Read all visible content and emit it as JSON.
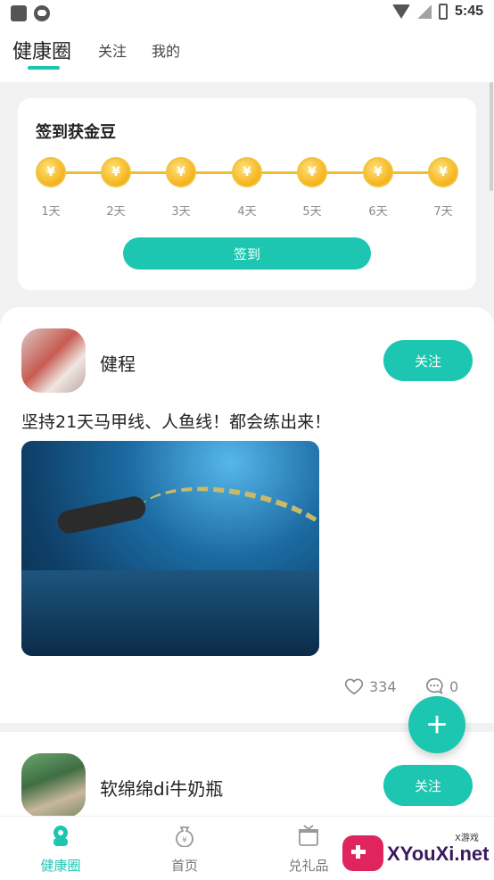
{
  "status_bar": {
    "time": "5:45"
  },
  "top_tabs": {
    "active": "健康圈",
    "follow": "关注",
    "mine": "我的"
  },
  "checkin": {
    "title": "签到获金豆",
    "coin_symbol": "¥",
    "days": [
      "1天",
      "2天",
      "3天",
      "4天",
      "5天",
      "6天",
      "7天"
    ],
    "button": "签到"
  },
  "posts": [
    {
      "username": "健程",
      "follow_label": "关注",
      "text": "坚持21天马甲线、人鱼线！都会练出来！",
      "likes": "334",
      "comments": "0"
    },
    {
      "username": "软绵绵di牛奶瓶",
      "follow_label": "关注"
    }
  ],
  "fab": {
    "symbol": "+"
  },
  "bottom_nav": [
    {
      "label": "健康圈",
      "active": true
    },
    {
      "label": "首页",
      "active": false
    },
    {
      "label": "兑礼品",
      "active": false
    }
  ],
  "watermark": {
    "text": "XYouXi.net",
    "small": "X游戏"
  },
  "colors": {
    "accent": "#1cc6b0",
    "coin": "#f5b31c"
  }
}
